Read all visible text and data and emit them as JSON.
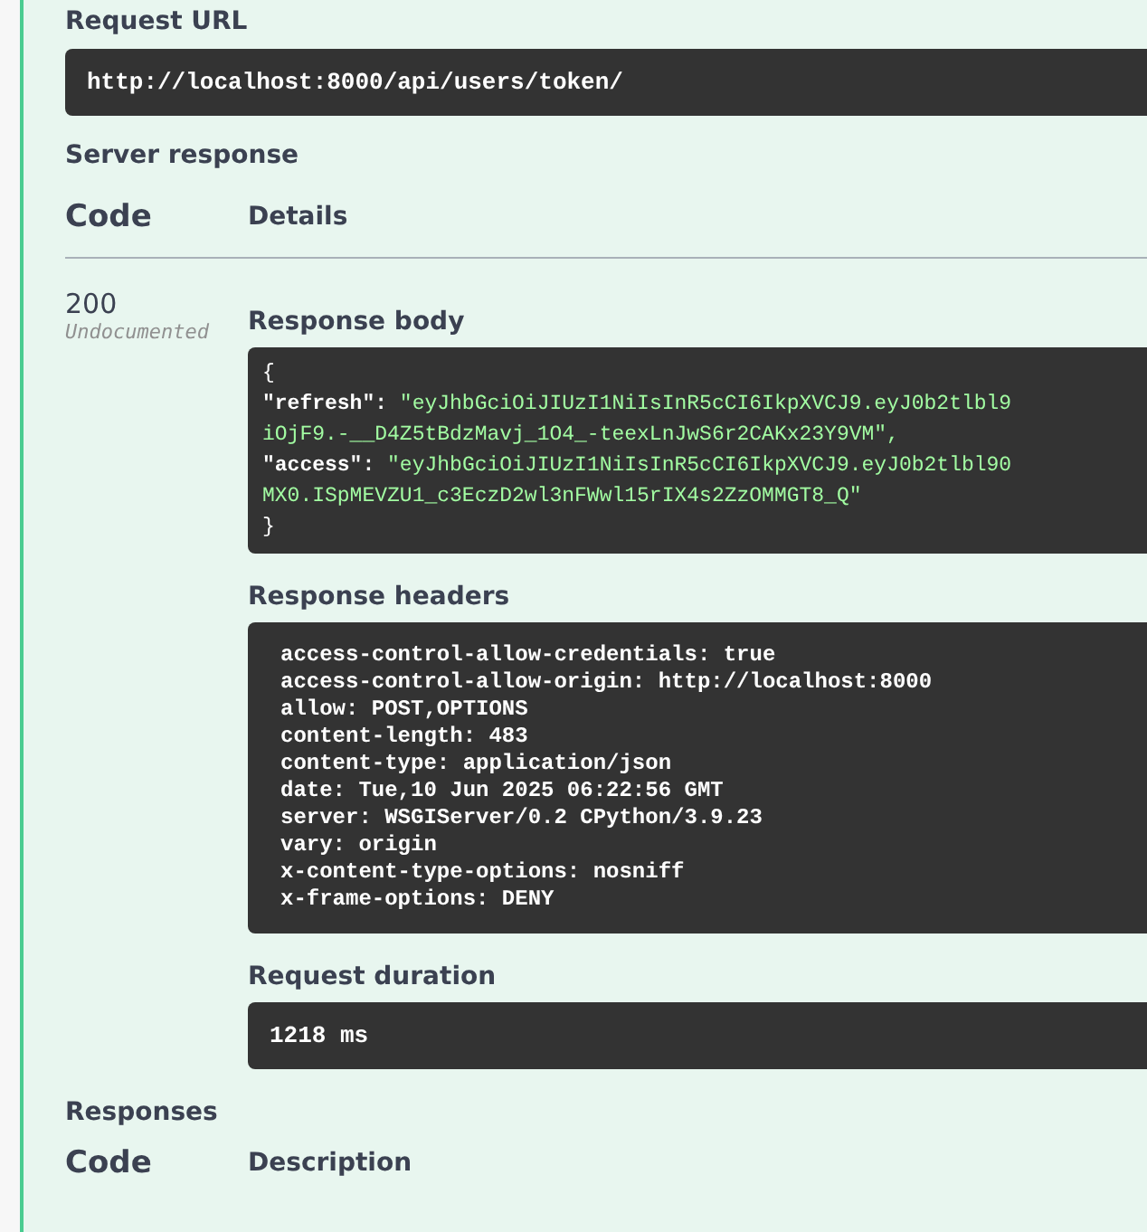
{
  "request_url": {
    "label": "Request URL",
    "value": "http://localhost:8000/api/users/token/"
  },
  "server_response": {
    "label": "Server response",
    "columns": [
      "Code",
      "Details"
    ],
    "code": "200",
    "code_note": "Undocumented",
    "body": {
      "label": "Response body",
      "lines": [
        {
          "kind": "punct",
          "text": "{"
        },
        {
          "kind": "pair",
          "key": "\"refresh\":",
          "value": "\"eyJhbGciOiJIUzI1NiIsInR5cCI6IkpXVCJ9.eyJ0b2tlbl9"
        },
        {
          "kind": "string",
          "text": "iOjF9.-__D4Z5tBdzMavj_1O4_-teexLnJwS6r2CAKx23Y9VM\","
        },
        {
          "kind": "pair",
          "key": "\"access\":",
          "value": "\"eyJhbGciOiJIUzI1NiIsInR5cCI6IkpXVCJ9.eyJ0b2tlbl90"
        },
        {
          "kind": "string",
          "text": "MX0.ISpMEVZU1_c3EczD2wl3nFWwl15rIX4s2ZzOMMGT8_Q\""
        },
        {
          "kind": "punct",
          "text": "}"
        }
      ]
    },
    "headers": {
      "label": "Response headers",
      "lines": [
        "access-control-allow-credentials: true",
        "access-control-allow-origin: http://localhost:8000",
        "allow: POST,OPTIONS",
        "content-length: 483",
        "content-type: application/json",
        "date: Tue,10 Jun 2025 06:22:56 GMT",
        "server: WSGIServer/0.2 CPython/3.9.23",
        "vary: origin",
        "x-content-type-options: nosniff",
        "x-frame-options: DENY"
      ]
    },
    "duration": {
      "label": "Request duration",
      "value": "1218 ms"
    }
  },
  "responses": {
    "label": "Responses",
    "columns": [
      "Code",
      "Description"
    ]
  }
}
